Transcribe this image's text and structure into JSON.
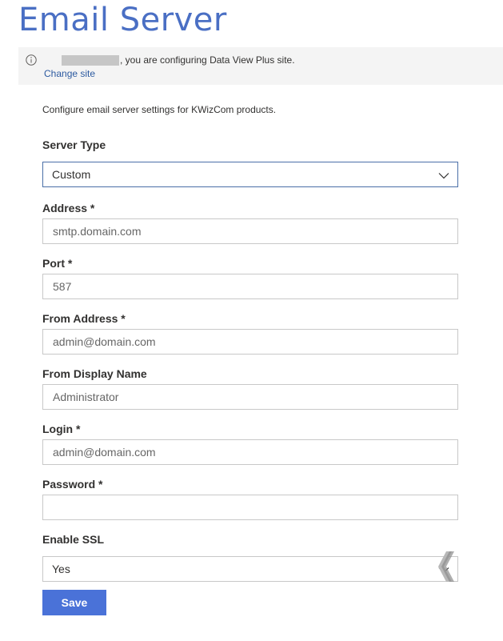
{
  "page": {
    "title": "Email Server"
  },
  "info_bar": {
    "message": ", you are configuring Data View Plus site.",
    "change_site_label": "Change site"
  },
  "description": "Configure email server settings for KWizCom products.",
  "form": {
    "server_type": {
      "label": "Server Type",
      "value": "Custom"
    },
    "address": {
      "label": "Address *",
      "value": "smtp.domain.com"
    },
    "port": {
      "label": "Port *",
      "value": "587"
    },
    "from_address": {
      "label": "From Address *",
      "value": "admin@domain.com"
    },
    "from_display_name": {
      "label": "From Display Name",
      "value": "Administrator"
    },
    "login": {
      "label": "Login *",
      "value": "admin@domain.com"
    },
    "password": {
      "label": "Password *",
      "value": ""
    },
    "enable_ssl": {
      "label": "Enable SSL",
      "value": "Yes"
    }
  },
  "actions": {
    "save_label": "Save"
  },
  "colors": {
    "title": "#4a6fc4",
    "link": "#2c5aa0",
    "primary_button": "#4a72d8",
    "info_bar_bg": "#f4f4f4"
  },
  "icons": {
    "info": "info-icon",
    "dropdown": "chevron-down-icon"
  }
}
